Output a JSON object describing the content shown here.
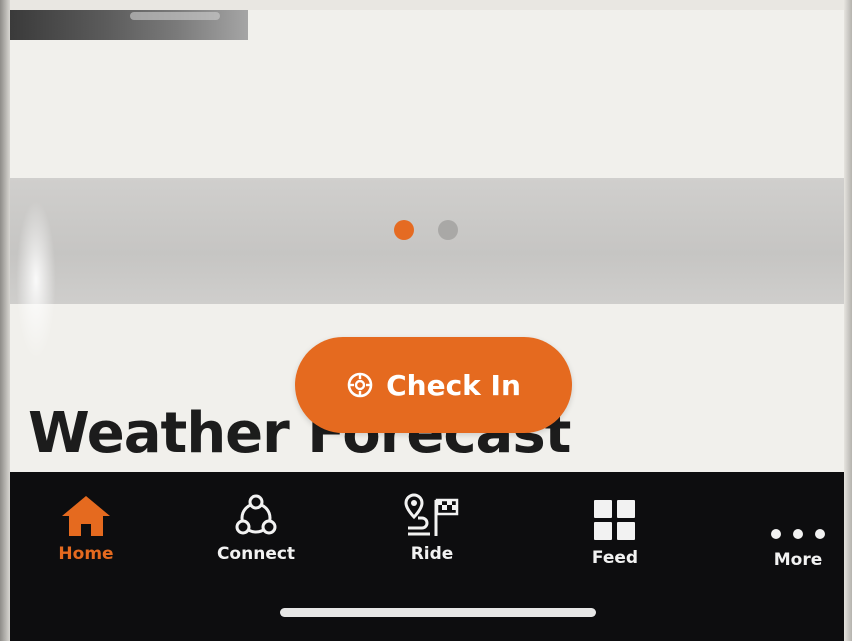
{
  "colors": {
    "accent": "#e56a1f",
    "tabbar_bg": "#0d0d0f",
    "inactive_dot": "#a9a8a6"
  },
  "carousel": {
    "page_count": 2,
    "active_index": 0
  },
  "checkin": {
    "label": "Check In",
    "icon": "target-icon"
  },
  "section": {
    "title": "Weather Forecast"
  },
  "tabs": [
    {
      "label": "Home",
      "icon": "home-icon",
      "active": true
    },
    {
      "label": "Connect",
      "icon": "network-icon",
      "active": false
    },
    {
      "label": "Ride",
      "icon": "route-flag-icon",
      "active": false
    },
    {
      "label": "Feed",
      "icon": "grid-icon",
      "active": false
    },
    {
      "label": "More",
      "icon": "ellipsis-icon",
      "active": false
    }
  ]
}
